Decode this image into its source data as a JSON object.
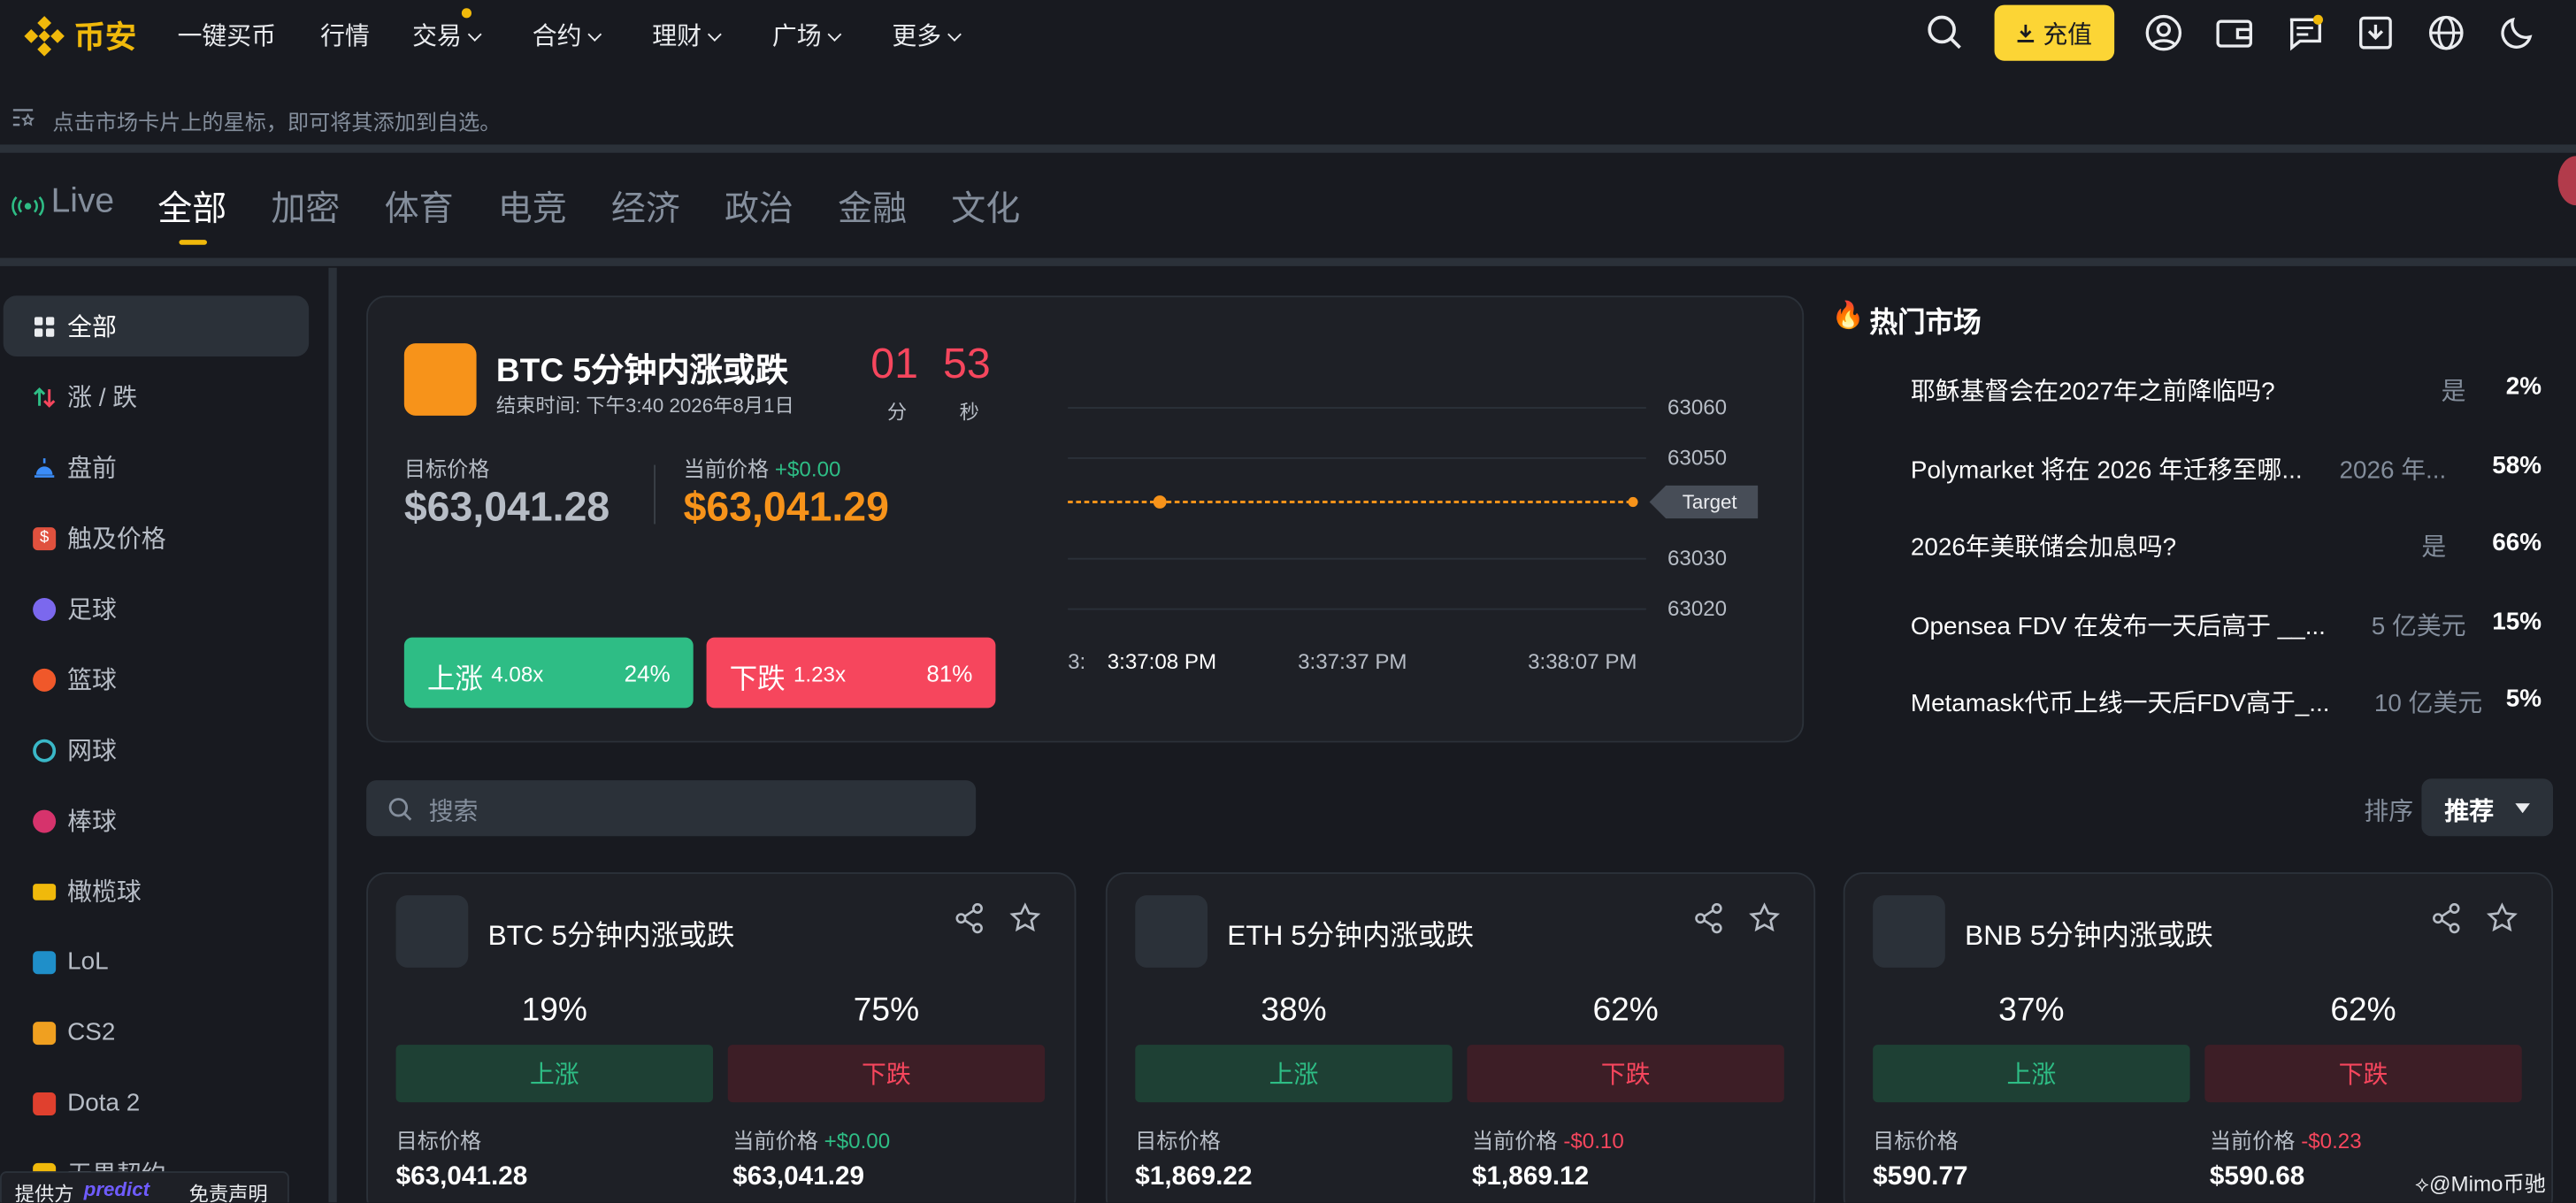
{
  "nav": {
    "brand": "币安",
    "items": [
      "一键买币",
      "行情",
      "交易",
      "合约",
      "理财",
      "广场",
      "更多"
    ],
    "deposit": "充值"
  },
  "hint": "点击市场卡片上的星标，即可将其添加到自选。",
  "categories": [
    "Live",
    "全部",
    "加密",
    "体育",
    "电竞",
    "经济",
    "政治",
    "金融",
    "文化"
  ],
  "sidebar": [
    "全部",
    "涨 / 跌",
    "盘前",
    "触及价格",
    "足球",
    "篮球",
    "网球",
    "棒球",
    "橄榄球",
    "LoL",
    "CS2",
    "Dota 2",
    "无畏契约"
  ],
  "featured": {
    "title": "BTC 5分钟内涨或跌",
    "end_time": "结束时间: 下午3:40 2026年8月1日",
    "countdown_min": "01",
    "countdown_sec": "53",
    "min_label": "分",
    "sec_label": "秒",
    "target_label": "目标价格",
    "target_price": "$63,041.28",
    "current_label": "当前价格",
    "current_change": "+$0.00",
    "current_price": "$63,041.29",
    "up_label": "上涨",
    "up_mult": "4.08x",
    "up_pct": "24%",
    "down_label": "下跌",
    "down_mult": "1.23x",
    "down_pct": "81%"
  },
  "chart_data": {
    "type": "line",
    "y_ticks": [
      "63060",
      "63050",
      "63030",
      "63020"
    ],
    "x_ticks": [
      "3:",
      "3:37:08 PM",
      "3:37:37 PM",
      "3:38:07 PM"
    ],
    "target_label": "Target",
    "ylim": [
      63016,
      63064
    ],
    "series": [
      {
        "values": [
          63041.28,
          63041.29
        ]
      }
    ]
  },
  "hot": {
    "title": "热门市场",
    "rows": [
      {
        "q": "耶稣基督会在2027年之前降临吗?",
        "o": "是",
        "p": "2%"
      },
      {
        "q": "Polymarket 将在 2026 年迁移至哪...",
        "o": "2026 年...",
        "p": "58%"
      },
      {
        "q": "2026年美联储会加息吗?",
        "o": "是",
        "p": "66%"
      },
      {
        "q": "Opensea FDV 在发布一天后高于 __...",
        "o": "5 亿美元",
        "p": "15%"
      },
      {
        "q": "Metamask代币上线一天后FDV高于_...",
        "o": "10 亿美元",
        "p": "5%"
      }
    ]
  },
  "search": {
    "placeholder": "搜索"
  },
  "sort": {
    "label": "排序",
    "value": "推荐"
  },
  "cards": [
    {
      "title": "BTC 5分钟内涨或跌",
      "up_pct": "19%",
      "down_pct": "75%",
      "up": "上涨",
      "down": "下跌",
      "target_label": "目标价格",
      "current_label": "当前价格",
      "change": "+$0.00",
      "target": "$63,041.28",
      "current": "$63,041.29"
    },
    {
      "title": "ETH 5分钟内涨或跌",
      "up_pct": "38%",
      "down_pct": "62%",
      "up": "上涨",
      "down": "下跌",
      "target_label": "目标价格",
      "current_label": "当前价格",
      "change": "-$0.10",
      "target": "$1,869.22",
      "current": "$1,869.12"
    },
    {
      "title": "BNB 5分钟内涨或跌",
      "up_pct": "37%",
      "down_pct": "62%",
      "up": "上涨",
      "down": "下跌",
      "target_label": "目标价格",
      "current_label": "当前价格",
      "change": "-$0.23",
      "target": "$590.77",
      "current": "$590.68"
    }
  ],
  "footer": {
    "provider": "提供方",
    "provider_name": "predict",
    "disclaimer": "免责声明",
    "watermark": "@Mimo币驰"
  },
  "colors": {
    "accent": "#f0b90b",
    "up": "#2ebd85",
    "down": "#f6465d",
    "orange": "#f7931a"
  }
}
